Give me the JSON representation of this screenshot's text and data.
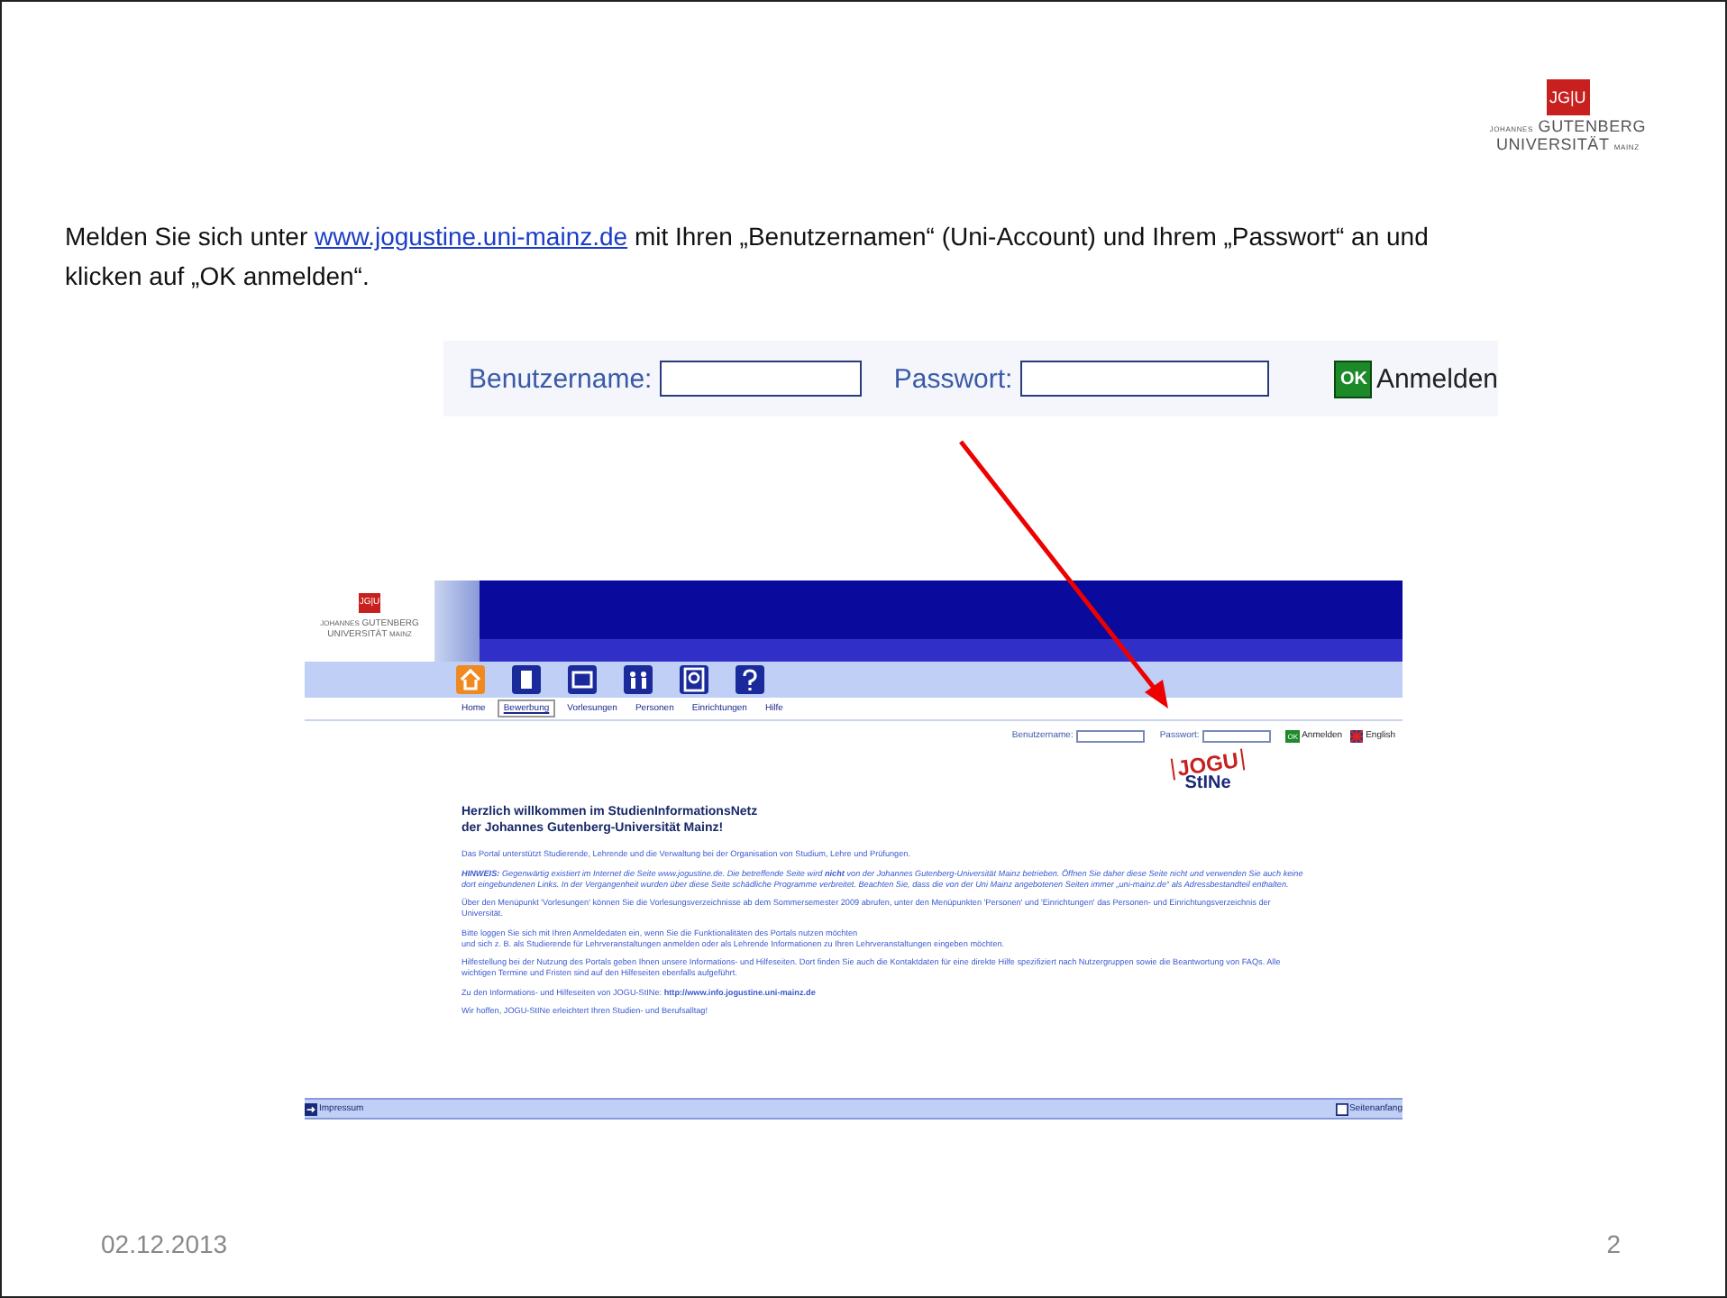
{
  "slide": {
    "logo": {
      "mark": "JG|U",
      "small_1": "JOHANNES",
      "line_1": "GUTENBERG",
      "line_2": "UNIVERSITÄT",
      "small_2": "MAINZ"
    },
    "instruction": {
      "before": "Melden Sie sich unter ",
      "link": "www.jogustine.uni-mainz.de",
      "after": " mit Ihren „Benutzernamen“ (Uni-Account) und Ihrem „Passwort“ an und klicken auf „OK anmelden“."
    },
    "login_crop": {
      "username_label": "Benutzername:",
      "password_label": "Passwort:",
      "ok_badge": "OK",
      "button_label": "Anmelden"
    },
    "web_page": {
      "logo": {
        "mark": "JG|U",
        "small_1": "JOHANNES",
        "line_1": "GUTENBERG",
        "line_2": "UNIVERSITÄT",
        "small_2": "MAINZ"
      },
      "nav": [
        {
          "label": "Home",
          "selected": false
        },
        {
          "label": "Bewerbung",
          "selected": true
        },
        {
          "label": "Vorlesungen",
          "selected": false
        },
        {
          "label": "Personen",
          "selected": false
        },
        {
          "label": "Einrichtungen",
          "selected": false
        },
        {
          "label": "Hilfe",
          "selected": false
        }
      ],
      "login": {
        "username_label": "Benutzername:",
        "password_label": "Passwort:",
        "ok_badge": "OK",
        "button_label": "Anmelden",
        "language_link": "English"
      },
      "stine_logo": {
        "top": "JOGU",
        "bottom": "StINe"
      },
      "heading": [
        "Herzlich willkommen im StudienInformationsNetz",
        "der Johannes Gutenberg-Universität Mainz!"
      ],
      "paragraphs": [
        {
          "kind": "plain",
          "lines": [
            "Das Portal unterstützt Studierende, Lehrende und die Verwaltung bei der Organisation von Studium, Lehre und Prüfungen."
          ]
        },
        {
          "kind": "notice",
          "lines": [
            "**HINWEIS:** Gegenwärtig existiert im Internet die Seite www.jogustine.de. Die betreffende Seite wird **nicht** von der Johannes Gutenberg-Universität Mainz betrieben. Öffnen Sie daher diese Seite nicht und verwenden Sie auch keine dort eingebundenen Links. In der Vergangenheit wurden über diese Seite schädliche Programme verbreitet. Beachten Sie, dass die von der Uni Mainz angebotenen Seiten immer „uni-mainz.de“ als Adressbestandteil enthalten."
          ]
        },
        {
          "kind": "plain",
          "lines": [
            "Über den Menüpunkt 'Vorlesungen' können Sie die Vorlesungsverzeichnisse ab dem Sommersemester 2009 abrufen, unter den Menüpunkten 'Personen' und 'Einrichtungen' das Personen- und Einrichtungsverzeichnis der Universität."
          ]
        },
        {
          "kind": "plain",
          "lines": [
            "Bitte loggen Sie sich mit Ihren Anmeldedaten ein, wenn Sie die Funktionalitäten des Portals nutzen möchten",
            "und sich z. B. als Studierende für Lehrveranstaltungen anmelden oder als Lehrende Informationen zu Ihren Lehrveranstaltungen eingeben möchten."
          ]
        },
        {
          "kind": "plain",
          "lines": [
            "Hilfestellung bei der Nutzung des Portals geben Ihnen unsere Informations- und Hilfeseiten. Dort finden Sie auch die Kontaktdaten für eine direkte Hilfe spezifiziert nach Nutzergruppen sowie die Beantwortung von FAQs. Alle wichtigen Termine und Fristen sind auf den Hilfeseiten ebenfalls aufgeführt."
          ]
        },
        {
          "kind": "plain",
          "lines": [
            "Zu den Informations- und Hilfeseiten von JOGU-StINe: **http://www.info.jogustine.uni-mainz.de**"
          ]
        },
        {
          "kind": "plain",
          "lines": [
            "Wir hoffen, JOGU-StINe erleichtert Ihren Studien- und Berufsalltag!"
          ]
        }
      ],
      "footer": {
        "left": "Impressum",
        "right": "Seitenanfang"
      }
    },
    "date": "02.12.2013",
    "page_number": "2"
  }
}
